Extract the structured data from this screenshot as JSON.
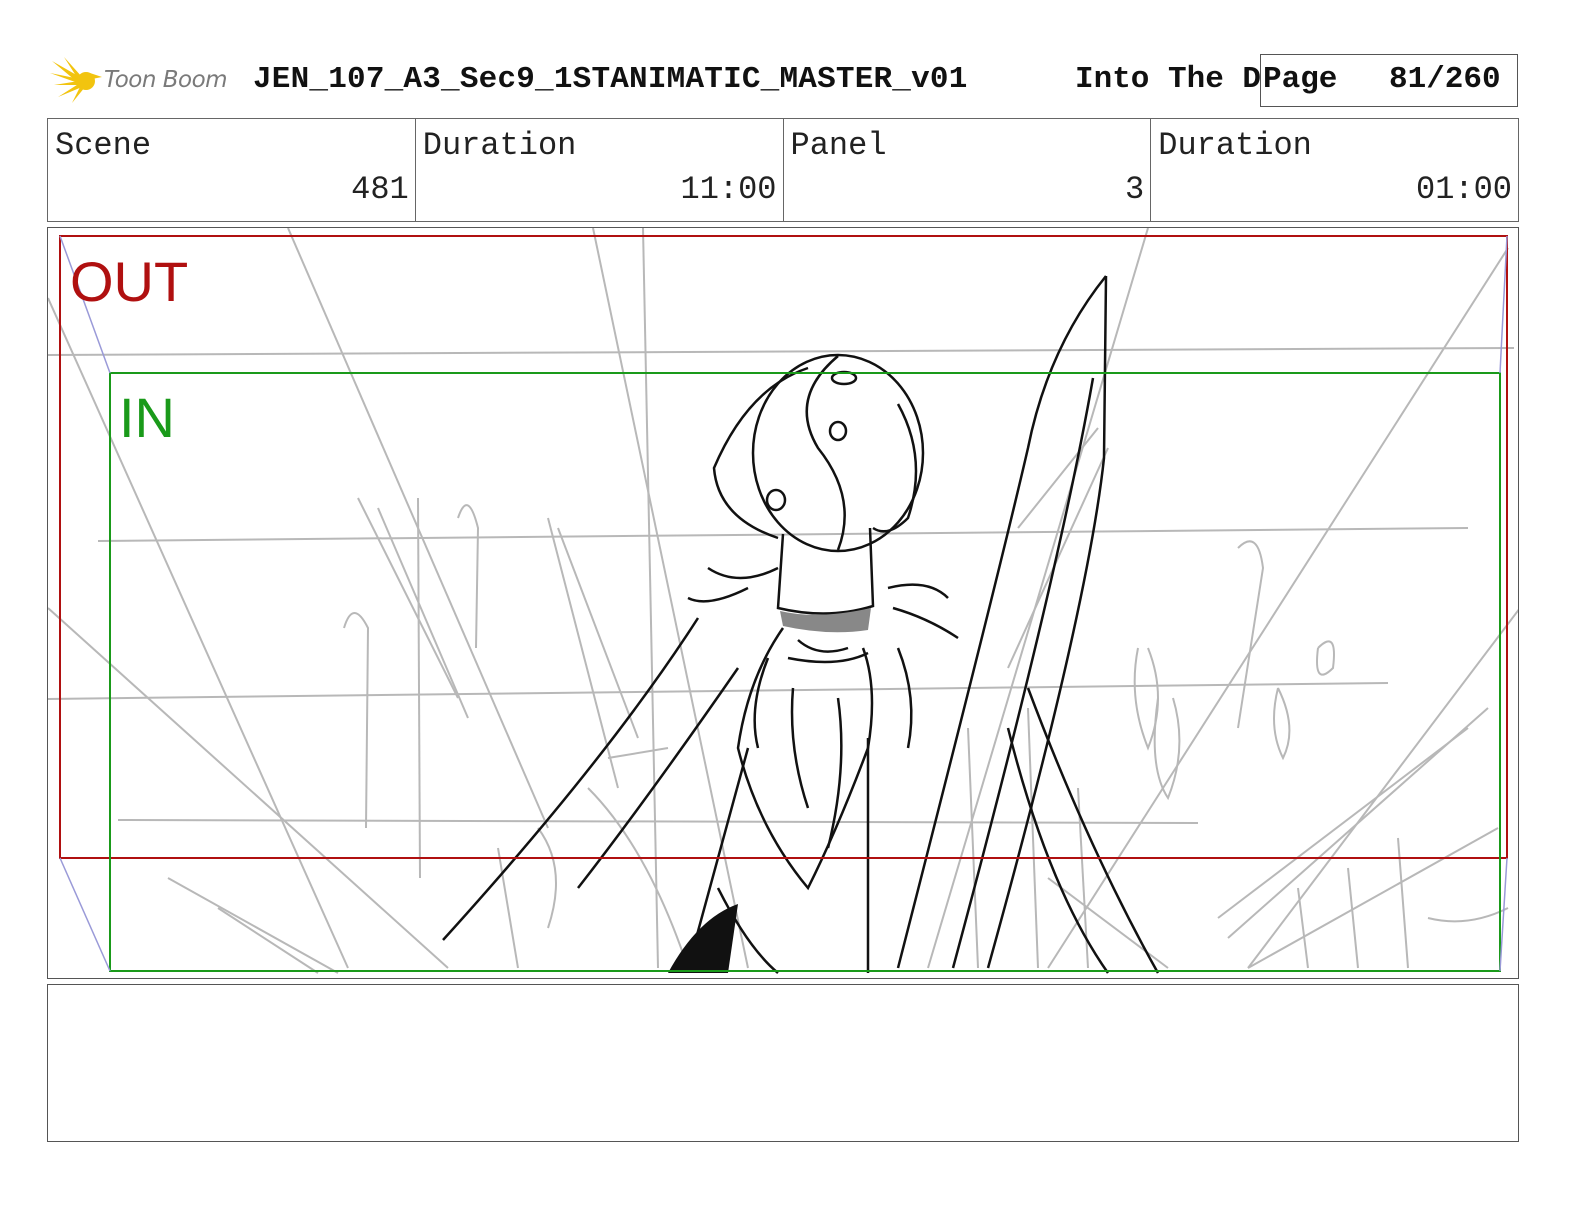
{
  "header": {
    "logo_text": "Toon Boom",
    "title": "JEN_107_A3_Sec9_1STANIMATIC_MASTER_v01",
    "show": "Into The Dragon's Peak",
    "page_label": "Page",
    "page_value": "81/260"
  },
  "info": [
    {
      "label": "Scene",
      "value": "481"
    },
    {
      "label": "Duration",
      "value": "11:00"
    },
    {
      "label": "Panel",
      "value": "3"
    },
    {
      "label": "Duration",
      "value": "01:00"
    }
  ],
  "panel": {
    "out_label": "OUT",
    "in_label": "IN"
  },
  "notes": {
    "text": ""
  },
  "colors": {
    "out_frame": "#b01010",
    "in_frame": "#1a9a1a",
    "logo_accent": "#f2c40f",
    "sketch_grey": "#b0b0b0",
    "sketch_ink": "#111111"
  },
  "icons": {
    "logo": "toon-boom-starburst-icon"
  }
}
